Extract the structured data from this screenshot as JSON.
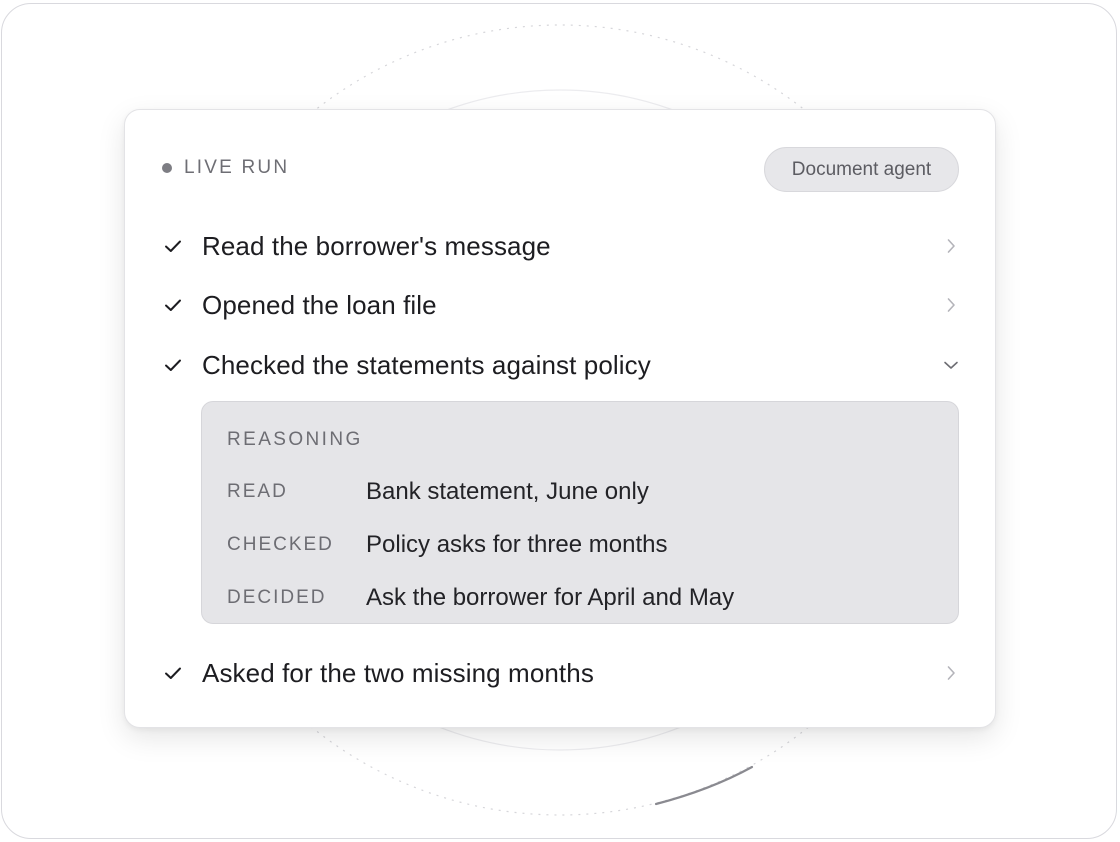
{
  "header": {
    "status_label": "LIVE RUN",
    "agent_badge": "Document agent"
  },
  "steps": [
    {
      "label": "Read the borrower's message",
      "state": "done",
      "expanded": false,
      "icon": "chevron-right-icon"
    },
    {
      "label": "Opened the loan file",
      "state": "done",
      "expanded": false,
      "icon": "chevron-right-icon"
    },
    {
      "label": "Checked the statements against policy",
      "state": "done",
      "expanded": true,
      "icon": "chevron-down-icon"
    },
    {
      "label": "Asked for the two missing months",
      "state": "done",
      "expanded": false,
      "icon": "chevron-right-icon"
    }
  ],
  "reasoning": {
    "title": "REASONING",
    "rows": [
      {
        "key": "READ",
        "value": "Bank statement, June only"
      },
      {
        "key": "CHECKED",
        "value": "Policy asks for three months"
      },
      {
        "key": "DECIDED",
        "value": "Ask the borrower for April and May"
      }
    ]
  },
  "colors": {
    "card_bg": "#ffffff",
    "panel_bg": "#e5e5e8",
    "text_primary": "#1d1d21",
    "text_muted": "#6d6d73",
    "badge_bg": "#e7e7ea"
  }
}
